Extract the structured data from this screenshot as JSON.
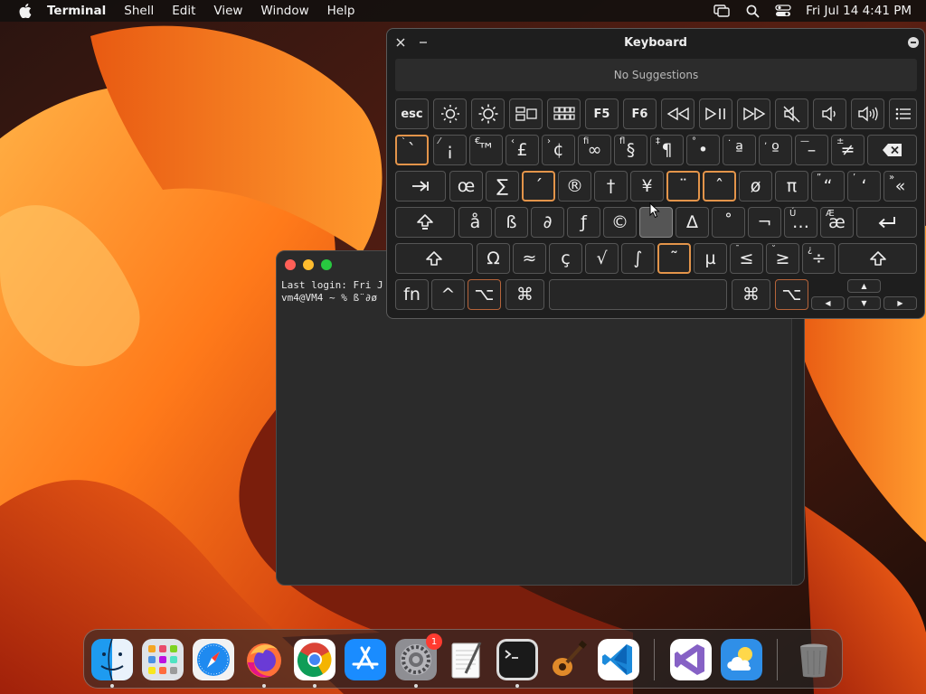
{
  "menubar": {
    "app_name": "Terminal",
    "menus": [
      "Shell",
      "Edit",
      "View",
      "Window",
      "Help"
    ],
    "clock": "Fri Jul 14  4:41 PM",
    "status_icons": [
      "screen-mirroring-icon",
      "search-icon",
      "control-center-icon"
    ]
  },
  "terminal": {
    "line1": "Last login: Fri J",
    "line2": "vm4@VM4 ~ % ß¨∂ø"
  },
  "keyboard_viewer": {
    "title": "Keyboard",
    "suggestions": "No Suggestions",
    "rows": {
      "fn_row": [
        "esc",
        "brightness-down-icon",
        "brightness-up-icon",
        "mission-control-icon",
        "launchpad-icon",
        "F5",
        "F6",
        "rewind-icon",
        "play-pause-icon",
        "fast-forward-icon",
        "mute-icon",
        "volume-down-icon",
        "volume-up-icon",
        "list-icon"
      ],
      "number_row": [
        {
          "main": "`",
          "sub": "`"
        },
        {
          "main": "¡",
          "sub": "⁄"
        },
        {
          "main": "™",
          "sub": "€"
        },
        {
          "main": "£",
          "sub": "‹"
        },
        {
          "main": "¢",
          "sub": "›"
        },
        {
          "main": "∞",
          "sub": "ﬁ"
        },
        {
          "main": "§",
          "sub": "ﬂ"
        },
        {
          "main": "¶",
          "sub": "‡"
        },
        {
          "main": "•",
          "sub": "°"
        },
        {
          "main": "ª",
          "sub": "·"
        },
        {
          "main": "º",
          "sub": "‚"
        },
        {
          "main": "–",
          "sub": "—"
        },
        {
          "main": "≠",
          "sub": "±"
        }
      ],
      "top_row": [
        {
          "main": "œ",
          "sub": ""
        },
        {
          "main": "∑",
          "sub": ""
        },
        {
          "main": "´",
          "sub": ""
        },
        {
          "main": "®",
          "sub": ""
        },
        {
          "main": "†",
          "sub": ""
        },
        {
          "main": "¥",
          "sub": ""
        },
        {
          "main": "¨",
          "sub": ""
        },
        {
          "main": "ˆ",
          "sub": ""
        },
        {
          "main": "ø",
          "sub": ""
        },
        {
          "main": "π",
          "sub": ""
        },
        {
          "main": "“",
          "sub": "”"
        },
        {
          "main": "‘",
          "sub": "’"
        },
        {
          "main": "«",
          "sub": "»"
        }
      ],
      "home_row": [
        {
          "main": "å",
          "sub": ""
        },
        {
          "main": "ß",
          "sub": ""
        },
        {
          "main": "∂",
          "sub": ""
        },
        {
          "main": "ƒ",
          "sub": ""
        },
        {
          "main": "©",
          "sub": ""
        },
        {
          "main": "˙",
          "sub": ""
        },
        {
          "main": "∆",
          "sub": ""
        },
        {
          "main": "˚",
          "sub": ""
        },
        {
          "main": "¬",
          "sub": ""
        },
        {
          "main": "…",
          "sub": "Ú"
        },
        {
          "main": "æ",
          "sub": "Æ"
        }
      ],
      "bottom_row": [
        {
          "main": "Ω",
          "sub": ""
        },
        {
          "main": "≈",
          "sub": ""
        },
        {
          "main": "ç",
          "sub": ""
        },
        {
          "main": "√",
          "sub": ""
        },
        {
          "main": "∫",
          "sub": ""
        },
        {
          "main": "˜",
          "sub": ""
        },
        {
          "main": "µ",
          "sub": ""
        },
        {
          "main": "≤",
          "sub": "¯"
        },
        {
          "main": "≥",
          "sub": "˘"
        },
        {
          "main": "÷",
          "sub": "¿"
        }
      ],
      "modifier_row": {
        "fn": "fn",
        "control": "^",
        "option": "⌥",
        "command": "⌘"
      }
    }
  },
  "dock": {
    "apps": [
      "Finder",
      "Launchpad",
      "Safari",
      "Firefox",
      "Chrome",
      "App Store",
      "System Settings",
      "TextEdit",
      "Terminal",
      "GarageBand",
      "Visual Studio Code",
      "Visual Studio",
      "Weather",
      "Trash"
    ],
    "settings_badge": "1"
  },
  "colors": {
    "highlight": "#e3944a",
    "key_bg": "#262626",
    "viewer_bg": "#1e1e1e"
  }
}
